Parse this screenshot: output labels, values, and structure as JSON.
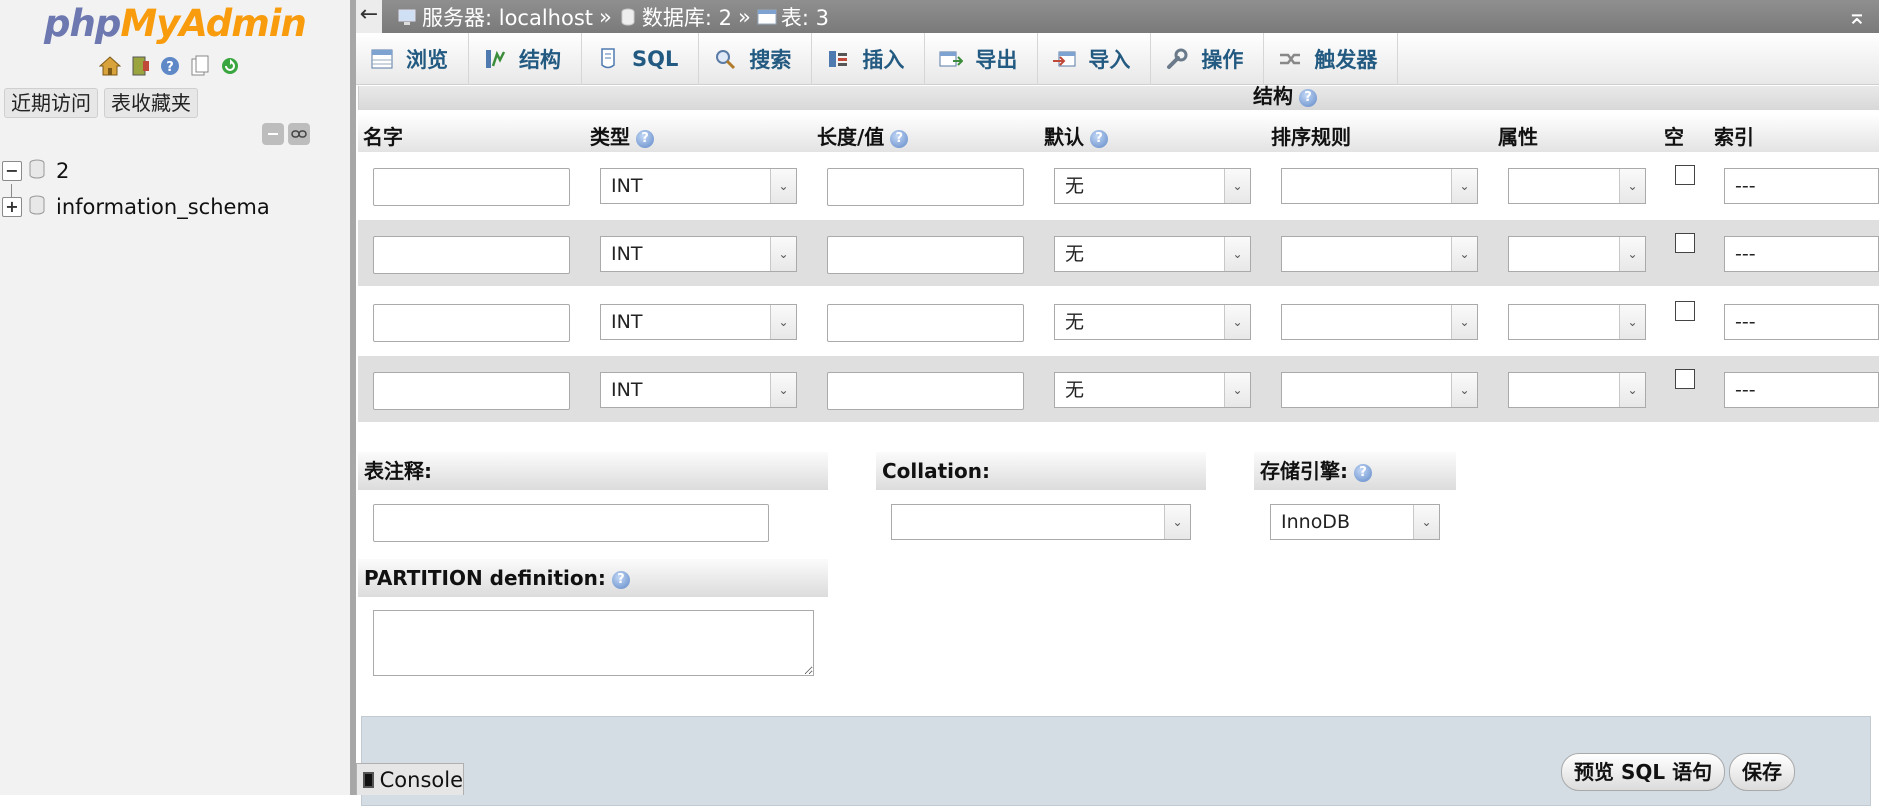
{
  "nav": {
    "logo": {
      "php": "php",
      "my": "My",
      "admin": "Admin"
    },
    "icons": [
      "home-icon",
      "logout-icon",
      "help-icon",
      "docs-icon",
      "reload-icon"
    ],
    "tabs": [
      "近期访问",
      "表收藏夹"
    ],
    "tree": [
      {
        "name": "2",
        "expanded": true
      },
      {
        "name": "information_schema",
        "expanded": false
      }
    ]
  },
  "breadcrumb": {
    "server": "服务器: localhost",
    "database": "数据库: 2",
    "table": "表: 3",
    "sep": "»"
  },
  "menu": [
    {
      "label": "浏览",
      "icon": "browse-icon"
    },
    {
      "label": "结构",
      "icon": "structure-icon"
    },
    {
      "label": "SQL",
      "icon": "sql-icon"
    },
    {
      "label": "搜索",
      "icon": "search-icon"
    },
    {
      "label": "插入",
      "icon": "insert-icon"
    },
    {
      "label": "导出",
      "icon": "export-icon"
    },
    {
      "label": "导入",
      "icon": "import-icon"
    },
    {
      "label": "操作",
      "icon": "wrench-icon"
    },
    {
      "label": "触发器",
      "icon": "triggers-icon"
    }
  ],
  "section_title": "结构",
  "columns": {
    "name": "名字",
    "type": "类型",
    "length": "长度/值",
    "default": "默认",
    "collation": "排序规则",
    "attributes": "属性",
    "null": "空",
    "index": "索引"
  },
  "rows": [
    {
      "type": "INT",
      "default": "无",
      "index": "---"
    },
    {
      "type": "INT",
      "default": "无",
      "index": "---"
    },
    {
      "type": "INT",
      "default": "无",
      "index": "---"
    },
    {
      "type": "INT",
      "default": "无",
      "index": "---"
    }
  ],
  "table_options": {
    "comment_label": "表注释:",
    "collation_label": "Collation:",
    "engine_label": "存储引擎:",
    "engine_value": "InnoDB",
    "partition_label": "PARTITION definition:"
  },
  "actions": {
    "preview_sql": "预览 SQL 语句",
    "save": "保存"
  },
  "console": "Console",
  "help_glyph": "?",
  "arrow_glyph": "⌄"
}
